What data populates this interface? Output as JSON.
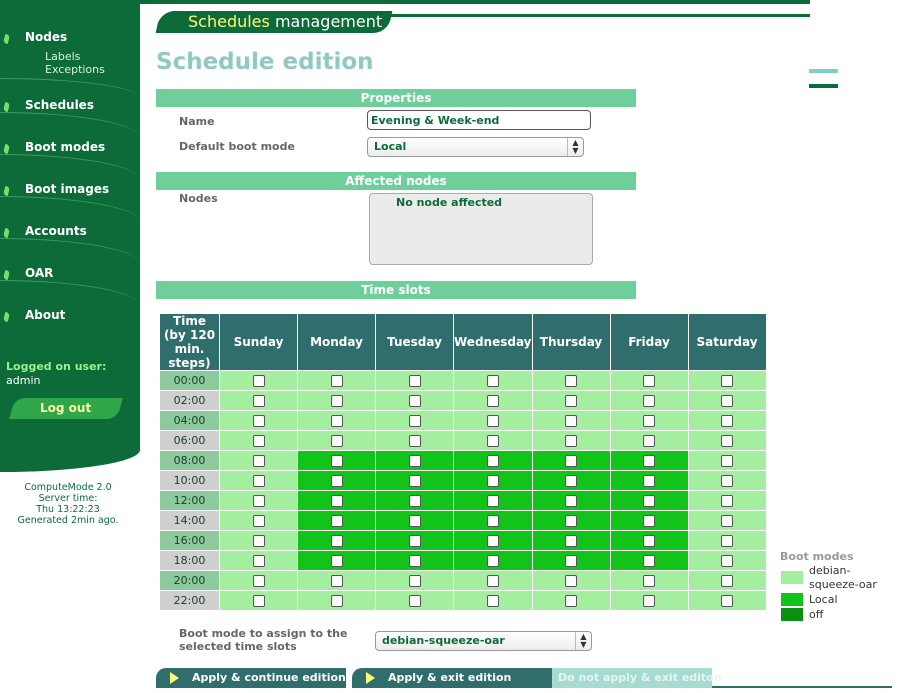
{
  "sidebar": {
    "items": [
      {
        "label": "Nodes"
      },
      {
        "label": "Schedules"
      },
      {
        "label": "Boot modes"
      },
      {
        "label": "Boot images"
      },
      {
        "label": "Accounts"
      },
      {
        "label": "OAR"
      },
      {
        "label": "About"
      }
    ],
    "sub_items": [
      "Labels",
      "Exceptions"
    ],
    "logged_label": "Logged on user:",
    "logged_user": "admin",
    "logout_label": "Log out",
    "version": [
      "ComputeMode 2.0",
      "Server time:",
      "Thu 13:22:23",
      "Generated 2min ago."
    ]
  },
  "header": {
    "banner_highlight": "Schedules",
    "banner_rest": " management"
  },
  "main": {
    "title": "Schedule edition",
    "properties": {
      "section": "Properties",
      "name_label": "Name",
      "name_value": "Evening & Week-end",
      "boot_mode_label": "Default boot mode",
      "boot_mode_value": "Local"
    },
    "affected": {
      "section": "Affected nodes",
      "nodes_label": "Nodes",
      "nodes_value": "No node affected"
    },
    "slots": {
      "section": "Time slots",
      "time_header": [
        "Time",
        "(by 120",
        "min.",
        "steps)"
      ],
      "days": [
        "Sunday",
        "Monday",
        "Tuesday",
        "Wednesday",
        "Thursday",
        "Friday",
        "Saturday"
      ],
      "times": [
        "00:00",
        "02:00",
        "04:00",
        "06:00",
        "08:00",
        "10:00",
        "12:00",
        "14:00",
        "16:00",
        "18:00",
        "20:00",
        "22:00"
      ],
      "grid": [
        [
          "debian",
          "debian",
          "debian",
          "debian",
          "debian",
          "debian",
          "debian"
        ],
        [
          "debian",
          "debian",
          "debian",
          "debian",
          "debian",
          "debian",
          "debian"
        ],
        [
          "debian",
          "debian",
          "debian",
          "debian",
          "debian",
          "debian",
          "debian"
        ],
        [
          "debian",
          "debian",
          "debian",
          "debian",
          "debian",
          "debian",
          "debian"
        ],
        [
          "debian",
          "local",
          "local",
          "local",
          "local",
          "local",
          "debian"
        ],
        [
          "debian",
          "local",
          "local",
          "local",
          "local",
          "local",
          "debian"
        ],
        [
          "debian",
          "local",
          "local",
          "local",
          "local",
          "local",
          "debian"
        ],
        [
          "debian",
          "local",
          "local",
          "local",
          "local",
          "local",
          "debian"
        ],
        [
          "debian",
          "local",
          "local",
          "local",
          "local",
          "local",
          "debian"
        ],
        [
          "debian",
          "local",
          "local",
          "local",
          "local",
          "local",
          "debian"
        ],
        [
          "debian",
          "debian",
          "debian",
          "debian",
          "debian",
          "debian",
          "debian"
        ],
        [
          "debian",
          "debian",
          "debian",
          "debian",
          "debian",
          "debian",
          "debian"
        ]
      ]
    },
    "legend": {
      "title": "Boot modes",
      "items": [
        {
          "key": "debian",
          "label": "debian-squeeze-oar",
          "color": "#a4ef9f"
        },
        {
          "key": "local",
          "label": "Local",
          "color": "#12c41a"
        },
        {
          "key": "off",
          "label": "off",
          "color": "#0a8f10"
        }
      ]
    },
    "assign": {
      "label_line1": "Boot mode to assign to the",
      "label_line2": "selected time slots",
      "value": "debian-squeeze-oar"
    },
    "buttons": {
      "apply_continue": "Apply & continue edition",
      "apply_exit": "Apply & exit edition",
      "no_apply": "Do not apply & exit editon"
    }
  }
}
